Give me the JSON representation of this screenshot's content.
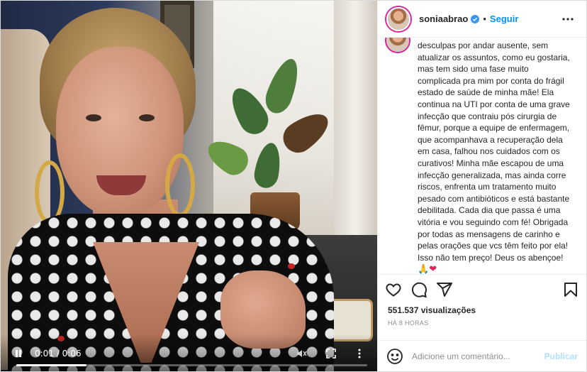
{
  "post": {
    "username": "soniaabrao",
    "separator": "•",
    "follow_label": "Seguir",
    "caption_lines": [
      "desculpas por andar ausente, sem",
      "atualizar os assuntos, como eu gostaria,",
      "mas tem sido uma fase muito",
      "complicada pra mim por conta do frágil",
      "estado de saúde de minha mãe! Ela",
      "continua na UTI por conta de uma grave",
      "infecção que contraiu pós cirurgia de",
      "fêmur, porque a equipe de enfermagem,",
      "que acompanhava a recuperação dela",
      "em casa, falhou nos cuidados com os",
      "curativos! Minha mãe escapou de uma",
      "infecção generalizada, mas ainda corre",
      "riscos, enfrenta um tratamento muito",
      "pesado com antibióticos e está bastante",
      "debilitada. Cada dia que passa é uma",
      "vitória e vou seguindo com fé! Obrigada",
      "por todas as mensagens de carinho e",
      "pelas orações que vcs têm feito por ela!",
      "Isso não tem preço! Deus os abençoe!"
    ],
    "caption_emojis": {
      "pray": "🙏",
      "heart": "❤"
    },
    "views": "551.537 visualizações",
    "time_ago": "HÁ 8 HORAS",
    "comment_placeholder": "Adicione um comentário...",
    "publish_label": "Publicar"
  },
  "video": {
    "current_time": "0:01",
    "separator": " / ",
    "duration": "0:06",
    "progress": 0.2
  },
  "icons": {
    "verified": "verified-badge-icon",
    "more": "more-options-icon",
    "like": "heart-icon",
    "comment": "comment-icon",
    "share": "share-icon",
    "save": "bookmark-icon",
    "emoji": "smile-icon",
    "pause": "pause-icon",
    "mute": "muted-speaker-icon",
    "fullscreen": "fullscreen-icon",
    "video_more": "vertical-dots-icon"
  },
  "colors": {
    "accent": "#0095f6",
    "publish_disabled": "#b2dffc",
    "meta_gray": "#8e8e8e",
    "heart_red": "#e0245e"
  }
}
